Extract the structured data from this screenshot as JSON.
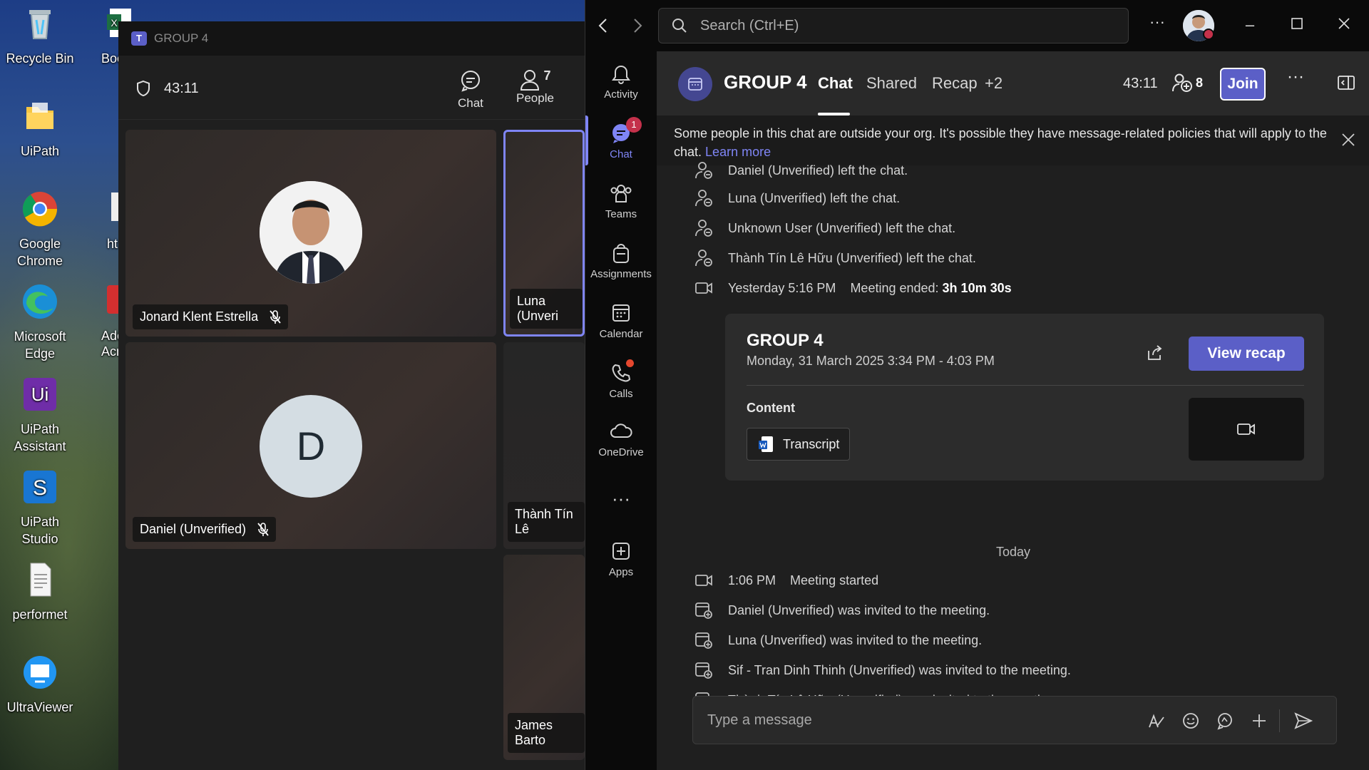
{
  "desktop": {
    "icons": [
      {
        "label": "Recycle Bin",
        "icon": "recycle-bin-icon"
      },
      {
        "label": "UiPath",
        "icon": "folder-icon"
      },
      {
        "label": "Google Chrome",
        "icon": "chrome-icon"
      },
      {
        "label": "Microsoft Edge",
        "icon": "edge-icon"
      },
      {
        "label": "UiPath Assistant",
        "icon": "uipath-assistant-icon"
      },
      {
        "label": "UiPath Studio",
        "icon": "uipath-studio-icon"
      },
      {
        "label": "performet",
        "icon": "text-file-icon"
      },
      {
        "label": "UltraViewer",
        "icon": "ultraviewer-icon"
      }
    ],
    "partial_icons": [
      "Boo",
      "ht",
      "Adc",
      "Acro"
    ]
  },
  "meeting": {
    "title": "GROUP 4",
    "timer": "43:11",
    "chat_label": "Chat",
    "people_label": "People",
    "people_count": "7",
    "participants": [
      {
        "name": "Jonard Klent Estrella"
      },
      {
        "name": "Luna (Unveri"
      },
      {
        "name": "Daniel (Unverified)",
        "initial": "D"
      },
      {
        "name": "Thành Tín Lê"
      },
      {
        "name": "James Barto"
      }
    ]
  },
  "teams": {
    "search_placeholder": "Search (Ctrl+E)",
    "rail": [
      {
        "label": "Activity",
        "icon": "bell-icon"
      },
      {
        "label": "Chat",
        "icon": "chat-icon",
        "badge": "1"
      },
      {
        "label": "Teams",
        "icon": "teams-icon"
      },
      {
        "label": "Assignments",
        "icon": "assignments-icon"
      },
      {
        "label": "Calendar",
        "icon": "calendar-icon"
      },
      {
        "label": "Calls",
        "icon": "phone-icon"
      },
      {
        "label": "OneDrive",
        "icon": "cloud-icon"
      },
      {
        "label": "Apps",
        "icon": "apps-icon"
      }
    ],
    "chat_header": {
      "title": "GROUP 4",
      "tabs": [
        "Chat",
        "Shared",
        "Recap",
        "+2"
      ],
      "timer": "43:11",
      "participants_count": "8",
      "join_label": "Join"
    },
    "banner": {
      "text": "Some people in this chat are outside your org. It's possible they have message-related policies that will apply to the chat.",
      "link": "Learn more"
    },
    "events_before": [
      "Daniel (Unverified) left the chat.",
      "Luna (Unverified) left the chat.",
      "Unknown User (Unverified) left the chat.",
      "Thành Tín Lê Hữu (Unverified) left the chat."
    ],
    "meeting_ended": {
      "time": "Yesterday 5:16 PM",
      "label": "Meeting ended:",
      "duration": "3h 10m 30s"
    },
    "recap_card": {
      "title": "GROUP 4",
      "datetime": "Monday, 31 March 2025 3:34 PM - 4:03 PM",
      "view_recap": "View recap",
      "content_label": "Content",
      "transcript_label": "Transcript"
    },
    "day_divider": "Today",
    "meeting_started": {
      "time": "1:06 PM",
      "label": "Meeting started"
    },
    "events_after": [
      "Daniel (Unverified) was invited to the meeting.",
      "Luna (Unverified) was invited to the meeting.",
      "Sif - Tran Dinh Thinh (Unverified) was invited to the meeting.",
      "Thành Tín Lê Hữu (Unverified) was invited to the meeting."
    ],
    "composer_placeholder": "Type a message"
  },
  "colors": {
    "accent": "#5b5fc7",
    "rail_active": "#7f85f5",
    "badge": "#c4314b"
  }
}
